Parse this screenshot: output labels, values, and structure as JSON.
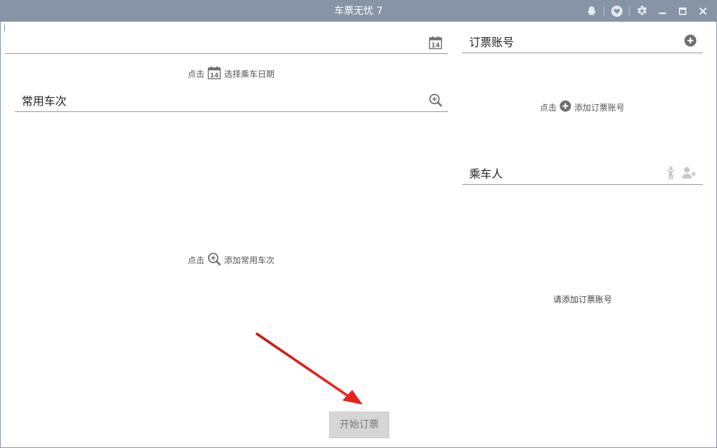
{
  "window": {
    "title": "车票无忧 7"
  },
  "titlebar_icons": [
    "qq-icon",
    "heart-icon",
    "gear-icon",
    "minimize-icon",
    "maximize-icon",
    "close-icon"
  ],
  "date": {
    "value": "",
    "hint_prefix": "点击",
    "hint_action": "选择乘车日期",
    "calendar_day": "14"
  },
  "trains": {
    "title": "常用车次",
    "hint_prefix": "点击",
    "hint_action": "添加常用车次"
  },
  "accounts": {
    "title": "订票账号",
    "hint_prefix": "点击",
    "hint_action": "添加订票账号"
  },
  "passengers": {
    "title": "乘车人",
    "empty_message": "请添加订票账号"
  },
  "actions": {
    "start_label": "开始订票"
  },
  "colors": {
    "titlebar": "#8794a6",
    "annotation_arrow": "#e0201c",
    "icon_gray": "#6f6f6f",
    "icon_light": "#c9c9c9"
  }
}
